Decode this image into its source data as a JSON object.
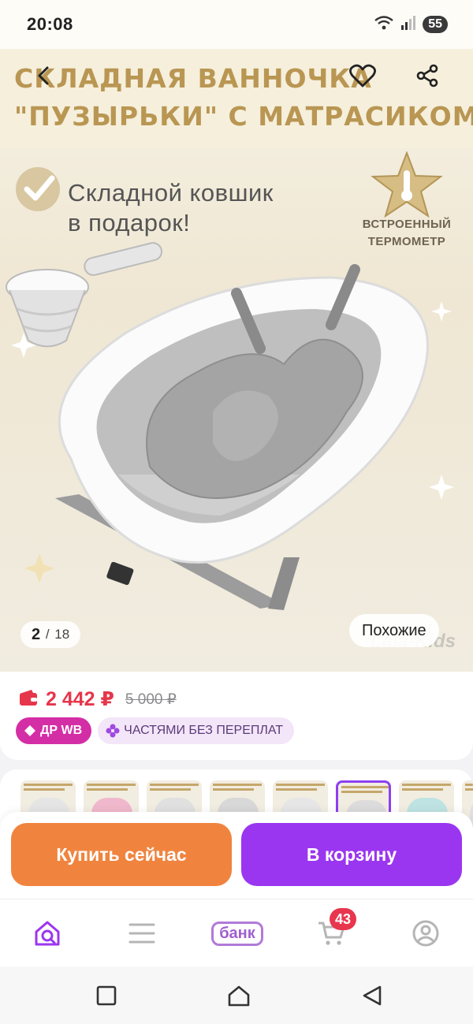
{
  "status_bar": {
    "time": "20:08",
    "battery": "55"
  },
  "product_image": {
    "title_line1": "СКЛАДНАЯ ВАННОЧКА",
    "title_line2": "\"ПУЗЫРЬКИ\" С МАТРАСИКОМ",
    "promo_line1": "Складной ковшик",
    "promo_line2": "в подарок!",
    "thermo_line1": "ВСТРОЕННЫЙ",
    "thermo_line2": "ТЕРМОМЕТР",
    "watermark": "Lala-Kids",
    "counter_current": "2",
    "counter_total": "18",
    "similar_label": "Похожие"
  },
  "price": {
    "current": "2 442 ₽",
    "old": "5 000 ₽"
  },
  "badges": {
    "dr": "ДР WB",
    "installments": "ЧАСТЯМИ БЕЗ ПЕРЕПЛАТ"
  },
  "thumbnails": {
    "active_index": 5,
    "tints": [
      "#e5e5e5",
      "#f0b8cc",
      "#e0e0e0",
      "#d8d8d8",
      "#e6e6e6",
      "#dcdcdc",
      "#bfe3e3",
      "#e0e0e0"
    ]
  },
  "actions": {
    "buy_now": "Купить сейчас",
    "add_to_cart": "В корзину"
  },
  "bottom_nav": {
    "bank_label": "банк",
    "cart_count": "43"
  },
  "colors": {
    "price": "#e6364b",
    "buy_button": "#f0843f",
    "cart_button": "#9b36f0",
    "accent": "#8e3ff0"
  }
}
